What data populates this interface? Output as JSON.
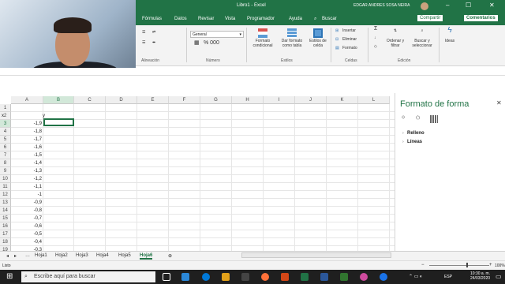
{
  "window": {
    "title": "Libro1 - Excel",
    "user": "EDGAR ANDRES SOSA NEIRA"
  },
  "menu": {
    "tabs": [
      "Fórmulas",
      "Datos",
      "Revisar",
      "Vista",
      "Programador",
      "Ayuda"
    ],
    "search_label": "Buscar",
    "share_label": "Compartir",
    "comments_label": "Comentarios"
  },
  "ribbon": {
    "font_value": "General",
    "number_format": "% 000",
    "groups": {
      "alignment": "Alineación",
      "number": "Número",
      "styles": "Estilos",
      "cells": "Celdas",
      "editing": "Edición"
    },
    "styles": {
      "conditional": [
        "Formato",
        "condicional"
      ],
      "table": [
        "Dar formato",
        "como tabla"
      ],
      "cell_styles": [
        "Estilos de",
        "celda"
      ]
    },
    "cells": {
      "insert": "Insertar",
      "delete": "Eliminar",
      "format": "Formato"
    },
    "editing": {
      "sort": [
        "Ordenar y",
        "filtrar"
      ],
      "find": [
        "Buscar y",
        "seleccionar"
      ],
      "ideas": "Ideas"
    }
  },
  "columns": [
    "A",
    "B",
    "C",
    "D",
    "E",
    "F",
    "G",
    "H",
    "I",
    "J",
    "K",
    "L"
  ],
  "rows": [
    1,
    2,
    3,
    4,
    5,
    6,
    7,
    8,
    9,
    10,
    11,
    12,
    13,
    14,
    15,
    16,
    17,
    18,
    19,
    20
  ],
  "cells": {
    "header_x": "x",
    "header_y": "y",
    "x_values": [
      "-1,9",
      "-1,8",
      "-1,7",
      "-1,6",
      "-1,5",
      "-1,4",
      "-1,3",
      "-1,2",
      "-1,1",
      "-1",
      "-0,9",
      "-0,8",
      "-0,7",
      "-0,6",
      "-0,5",
      "-0,4",
      "-0,3"
    ]
  },
  "panel": {
    "title": "Formato de forma",
    "sections": [
      "Relleno",
      "Líneas"
    ]
  },
  "sheets": {
    "tabs": [
      "Hoja1",
      "Hoja2",
      "Hoja3",
      "Hoja4",
      "Hoja5",
      "Hoja6"
    ],
    "active": "Hoja6"
  },
  "status": {
    "mode": "Listo",
    "zoom": "100%"
  },
  "taskbar": {
    "search_placeholder": "Escribe aquí para buscar",
    "language": "ESP",
    "time": "10:30 a. m.",
    "date": "24/03/2020"
  },
  "colors": {
    "excel_green": "#217346",
    "taskbar": "#1f1f1f"
  }
}
